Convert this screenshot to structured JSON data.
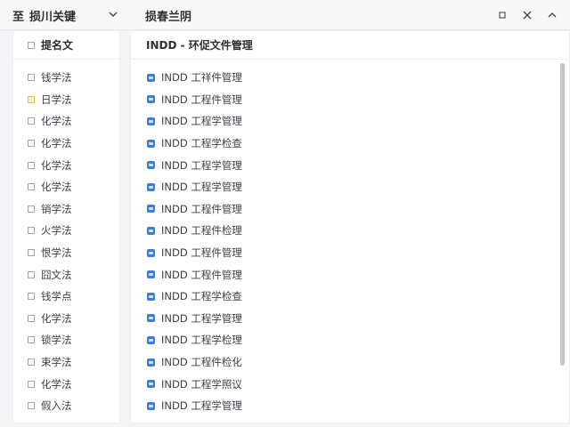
{
  "topbar": {
    "left_icon": "至",
    "left_title": "损川关键",
    "right_title": "损春兰阴"
  },
  "left_panel": {
    "header": "提名文",
    "items": [
      {
        "label": "钱学法",
        "highlight": false
      },
      {
        "label": "日学法",
        "highlight": true
      },
      {
        "label": "化学法",
        "highlight": false
      },
      {
        "label": "化学法",
        "highlight": false
      },
      {
        "label": "化学法",
        "highlight": false
      },
      {
        "label": "化学法",
        "highlight": false
      },
      {
        "label": "销学法",
        "highlight": false
      },
      {
        "label": "火学法",
        "highlight": false
      },
      {
        "label": "恨学法",
        "highlight": false
      },
      {
        "label": "囧文法",
        "highlight": false
      },
      {
        "label": "钱学点",
        "highlight": false
      },
      {
        "label": "化学法",
        "highlight": false
      },
      {
        "label": "锁学法",
        "highlight": false
      },
      {
        "label": "束学法",
        "highlight": false
      },
      {
        "label": "化学法",
        "highlight": false
      },
      {
        "label": "假入法",
        "highlight": false
      }
    ]
  },
  "main_panel": {
    "header": "INDD - 环促文件管理",
    "items": [
      "INDD 工祥件管理",
      "INDD 工程件管理",
      "INDD 工程学管理",
      "INDD 工程学检查",
      "INDD 工程学管理",
      "INDD 工程学管理",
      "INDD 工程件管理",
      "INDD 工程件检理",
      "INDD 工程件管理",
      "INDD 工程件管理",
      "INDD 工程学检查",
      "INDD 工程学管理",
      "INDD 工程学检理",
      "INDD 工程件检化",
      "INDD 工程学照议",
      "INDD 工程学管理"
    ]
  },
  "colors": {
    "file_icon": "#3b7de0",
    "scrollbar": "#c3c7cc",
    "highlight_checkbox": "#e0b54a"
  }
}
